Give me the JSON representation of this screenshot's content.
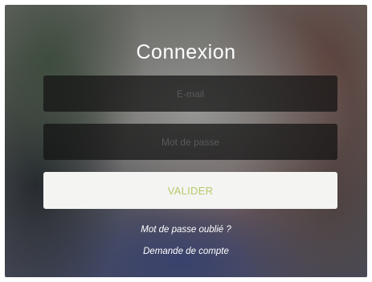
{
  "login": {
    "title": "Connexion",
    "email_placeholder": "E-mail",
    "password_placeholder": "Mot de passe",
    "submit_label": "VALIDER",
    "forgot_password_link": "Mot de passe oublié ?",
    "account_request_link": "Demande de compte"
  },
  "colors": {
    "submit_text": "#b6cc6a",
    "submit_background": "#f4f4f2",
    "field_background": "#1a1a1a"
  }
}
